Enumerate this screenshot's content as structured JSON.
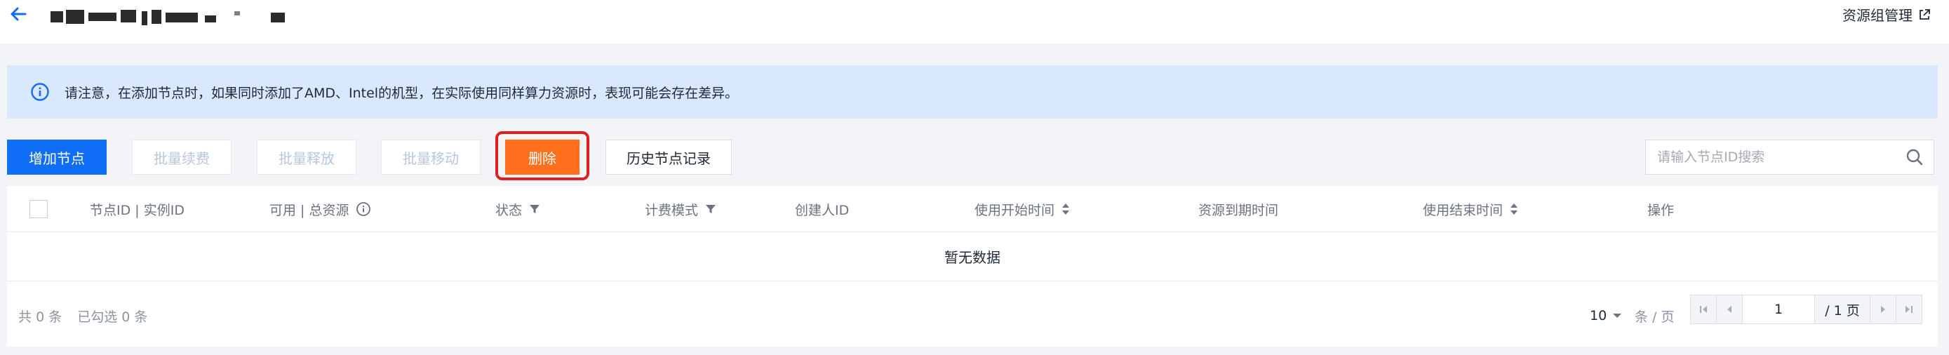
{
  "header": {
    "resource_group_link": "资源组管理"
  },
  "alert": {
    "text": "请注意，在添加节点时，如果同时添加了AMD、Intel的机型，在实际使用同样算力资源时，表现可能会存在差异。"
  },
  "toolbar": {
    "add_node": "增加节点",
    "batch_renew": "批量续费",
    "batch_release": "批量释放",
    "batch_move": "批量移动",
    "delete": "删除",
    "history": "历史节点记录"
  },
  "search": {
    "placeholder": "请输入节点ID搜索"
  },
  "table": {
    "columns": {
      "node_id": "节点ID | 实例ID",
      "resources": "可用 | 总资源",
      "status": "状态",
      "billing": "计费模式",
      "creator": "创建人ID",
      "start_time": "使用开始时间",
      "expire_time": "资源到期时间",
      "end_time": "使用结束时间",
      "actions": "操作"
    },
    "empty_text": "暂无数据"
  },
  "pagination": {
    "total_label": "共",
    "total_count": "0",
    "total_unit": "条",
    "selected_label": "已勾选",
    "selected_count": "0",
    "selected_unit": "条",
    "page_size": "10",
    "per_page_label": "条 / 页",
    "current_page": "1",
    "total_pages": "/ 1 页"
  },
  "colors": {
    "primary": "#0f6ef5",
    "danger": "#ff6f1c",
    "alert_bg": "#d9e8fd",
    "highlight": "#e02020"
  }
}
